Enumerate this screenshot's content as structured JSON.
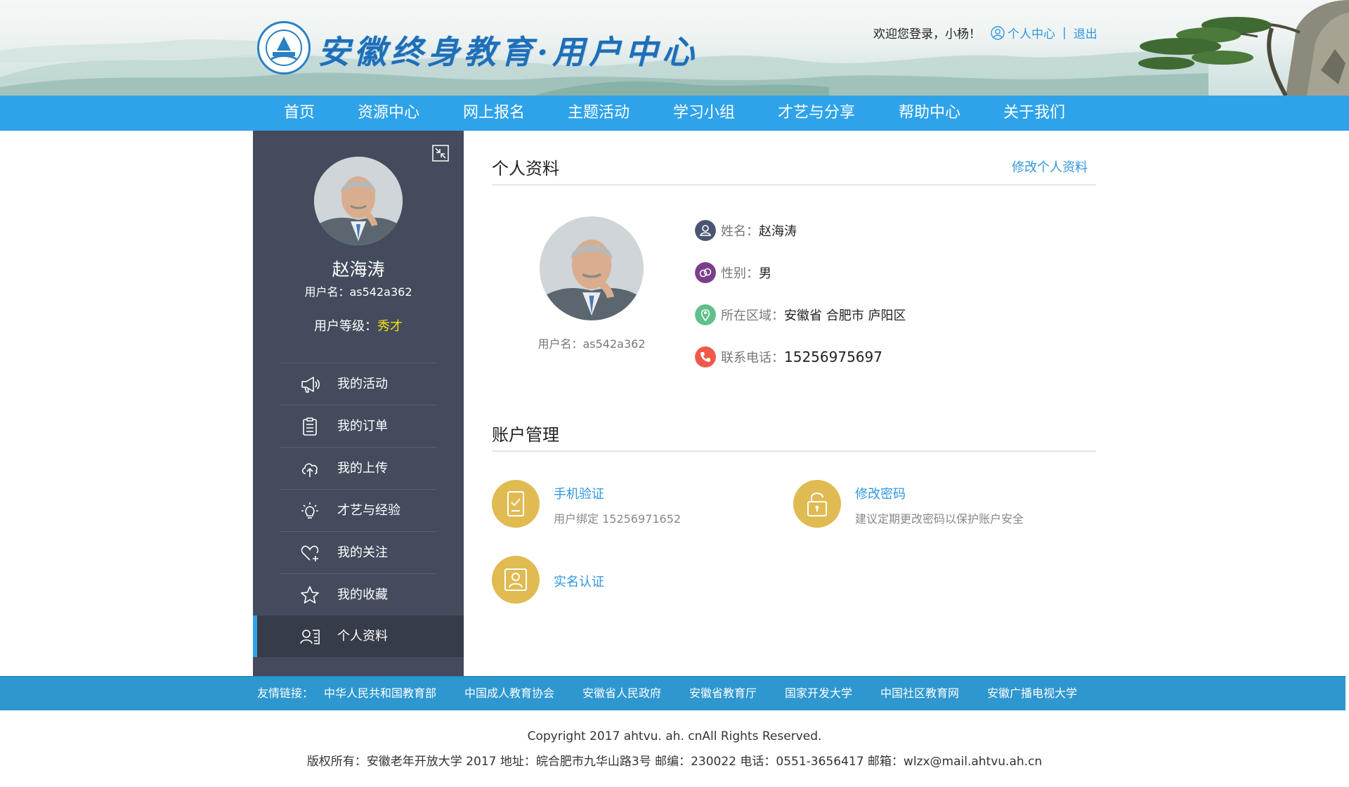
{
  "header": {
    "site_title": "安徽终身教育·用户中心",
    "welcome_text": "欢迎您登录，小杨！",
    "user_center_label": "个人中心",
    "separator": "|",
    "logout_label": "退出"
  },
  "nav": {
    "items": [
      "首页",
      "资源中心",
      "网上报名",
      "主题活动",
      "学习小组",
      "才艺与分享",
      "帮助中心",
      "关于我们"
    ]
  },
  "sidebar": {
    "name": "赵海涛",
    "username": "用户名：as542a362",
    "level_label": "用户等级：",
    "level_value": "秀才",
    "menu": [
      {
        "label": "我的活动",
        "icon": "megaphone-icon"
      },
      {
        "label": "我的订单",
        "icon": "clipboard-icon"
      },
      {
        "label": "我的上传",
        "icon": "cloud-upload-icon"
      },
      {
        "label": "才艺与经验",
        "icon": "lightbulb-icon"
      },
      {
        "label": "我的关注",
        "icon": "heart-plus-icon"
      },
      {
        "label": "我的收藏",
        "icon": "star-icon"
      },
      {
        "label": "个人资料",
        "icon": "profile-card-icon",
        "active": true
      }
    ]
  },
  "profile": {
    "section_title": "个人资料",
    "edit_label": "修改个人资料",
    "username": "用户名：as542a362",
    "fields": [
      {
        "label": "姓名：",
        "value": "赵海涛",
        "icon": "user-icon",
        "color": "#4a5670"
      },
      {
        "label": "性别：",
        "value": "男",
        "icon": "gender-icon",
        "color": "#7b3f8a"
      },
      {
        "label": "所在区域：",
        "value": "安徽省 合肥市 庐阳区",
        "icon": "location-icon",
        "color": "#5fc08b"
      },
      {
        "label": "联系电话：",
        "value": "15256975697",
        "icon": "phone-icon",
        "color": "#ef5a4a"
      }
    ]
  },
  "account": {
    "section_title": "账户管理",
    "items": [
      {
        "title": "手机验证",
        "subtitle": "用户绑定  15256971652",
        "icon": "phone-verify-icon"
      },
      {
        "title": "修改密码",
        "subtitle": "建议定期更改密码以保护账户安全",
        "icon": "lock-icon"
      },
      {
        "title": "实名认证",
        "subtitle": "",
        "icon": "id-card-icon"
      }
    ],
    "accent_color": "#e0bb52"
  },
  "footer": {
    "links_label": "友情链接：",
    "links": [
      "中华人民共和国教育部",
      "中国成人教育协会",
      "安徽省人民政府",
      "安徽省教育厅",
      "国家开发大学",
      "中国社区教育网",
      "安徽广播电视大学"
    ],
    "copyright": "Copyright 2017 ahtvu. ah. cnAll Rights Reserved.",
    "address": "版权所有：安徽老年开放大学 2017 地址：皖合肥市九华山路3号 邮编：230022 电话：0551-3656417 邮箱：wlzx@mail.ahtvu.ah.cn"
  },
  "colors": {
    "nav_blue": "#2fa3e9",
    "sidebar_bg": "#434b5c",
    "link_blue": "#2f97e0",
    "level_yellow": "#f5e11a",
    "footer_blue": "#2e97cf"
  }
}
